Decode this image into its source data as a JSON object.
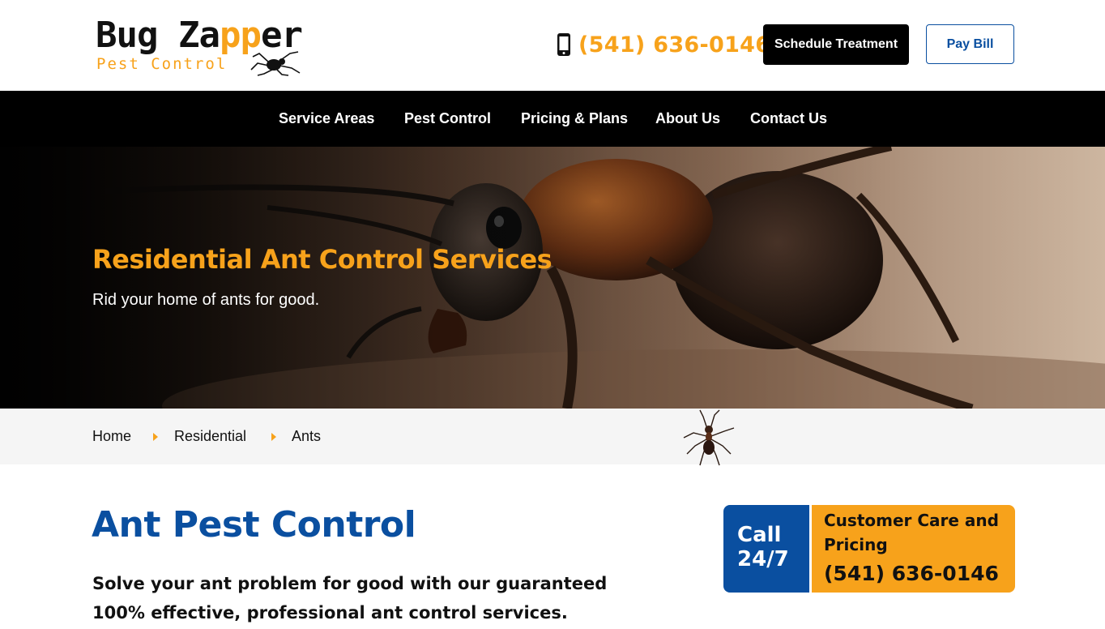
{
  "header": {
    "logo": {
      "word1": "Bug",
      "word2_black": "Za",
      "word2_orange": "pp",
      "word2_black_end": "er",
      "tagline": "Pest Control"
    },
    "phone": "(541) 636-0146",
    "schedule_label": "Schedule Treatment",
    "pay_label": "Pay Bill"
  },
  "nav": {
    "items": [
      {
        "label": "Service Areas"
      },
      {
        "label": "Pest Control"
      },
      {
        "label": "Pricing & Plans"
      },
      {
        "label": "About Us"
      },
      {
        "label": "Contact Us"
      }
    ]
  },
  "hero": {
    "title": "Residential Ant Control Services",
    "subtitle": "Rid your home of ants for good."
  },
  "breadcrumb": {
    "items": [
      {
        "label": "Home"
      },
      {
        "label": "Residential"
      },
      {
        "label": "Ants"
      }
    ]
  },
  "main": {
    "title": "Ant Pest Control",
    "intro": "Solve your ant problem for good with our guaranteed 100% effective, professional ant control services."
  },
  "callbox": {
    "left_line1": "Call",
    "left_line2": "24/7",
    "title": "Customer Care and Pricing",
    "phone": "(541) 636-0146"
  },
  "colors": {
    "brand_orange": "#f7a21b",
    "brand_blue": "#0a4fa0",
    "nav_bg": "#000000"
  },
  "icons": {
    "phone": "mobile-phone-icon",
    "breadcrumb_separator": "caret-right-icon",
    "logo_spider": "spider-icon",
    "decor_ant": "ant-icon"
  }
}
